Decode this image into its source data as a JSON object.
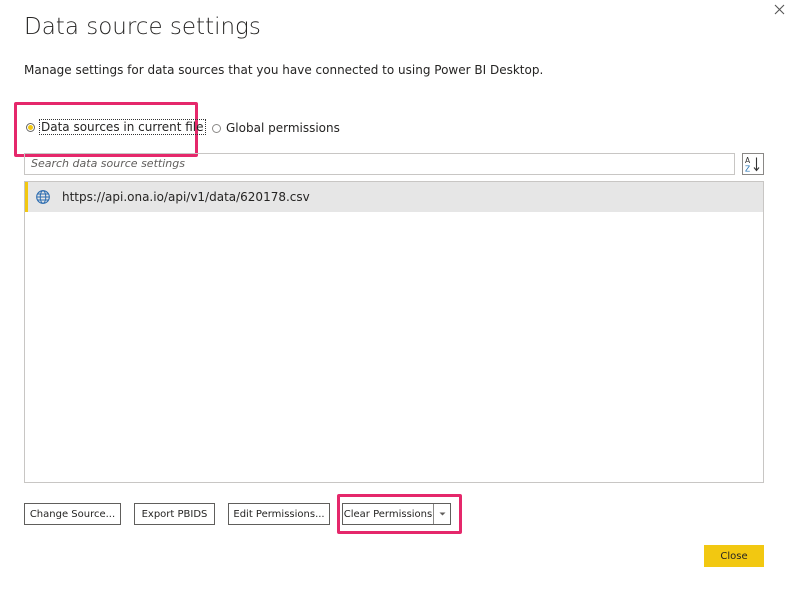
{
  "dialog": {
    "title": "Data source settings",
    "description": "Manage settings for data sources that you have connected to using Power BI Desktop."
  },
  "scope": {
    "options": [
      {
        "label": "Data sources in current file",
        "checked": true
      },
      {
        "label": "Global permissions",
        "checked": false
      }
    ]
  },
  "search": {
    "placeholder": "Search data source settings"
  },
  "sources": [
    {
      "icon": "globe-icon",
      "url": "https://api.ona.io/api/v1/data/620178.csv",
      "selected": true
    }
  ],
  "buttons": {
    "change_source": "Change Source...",
    "export_pbids": "Export PBIDS",
    "edit_permissions": "Edit Permissions...",
    "clear_permissions": "Clear Permissions",
    "close": "Close"
  },
  "colors": {
    "accent_yellow": "#f2c811",
    "highlight_pink": "#e5286b",
    "selected_row": "#e6e6e6"
  }
}
